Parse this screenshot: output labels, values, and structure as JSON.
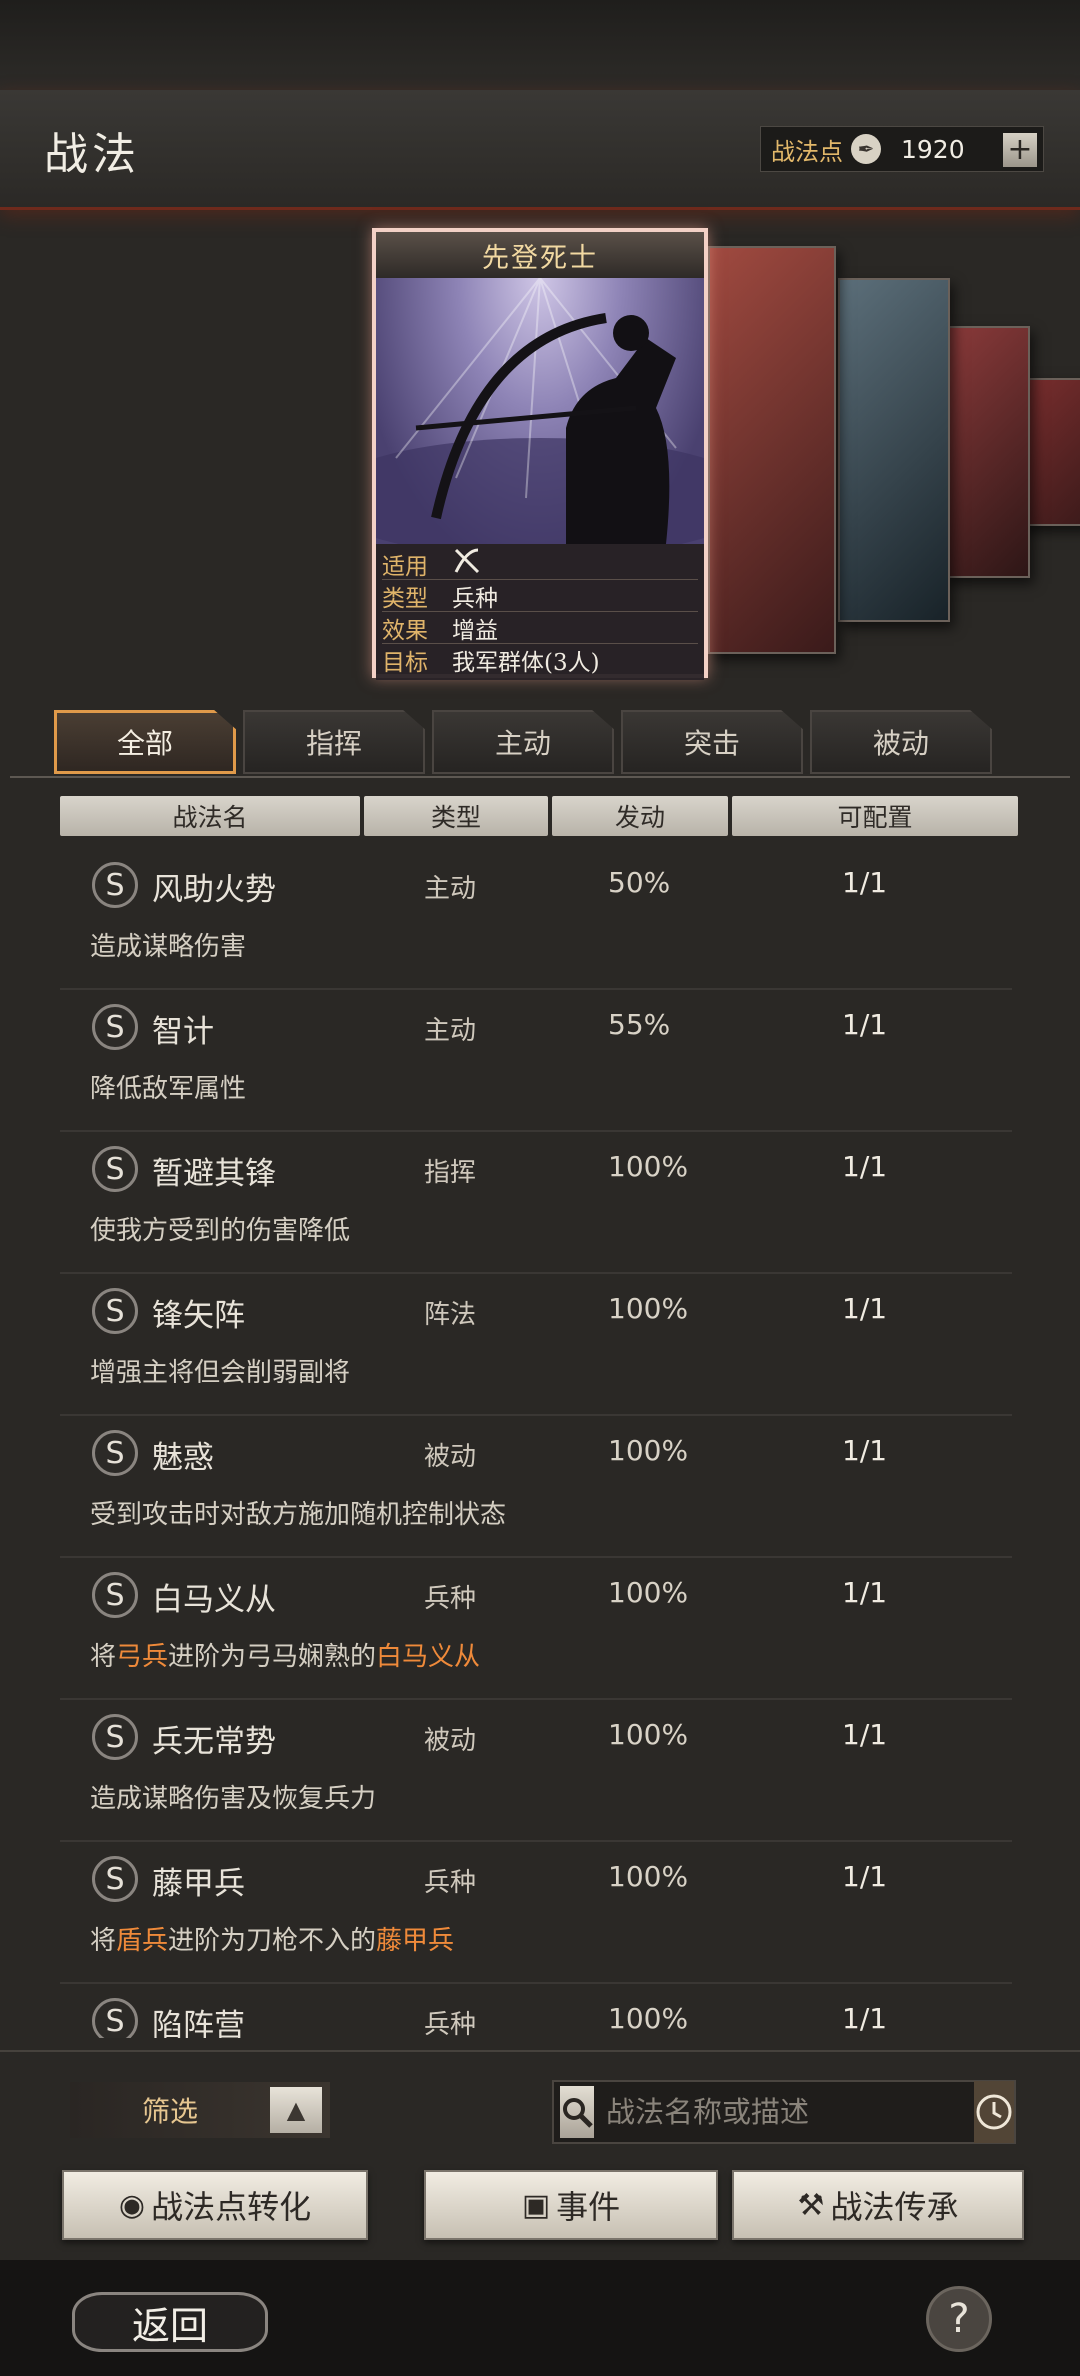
{
  "header": {
    "title": "战法",
    "points_label": "战法点",
    "points_icon": "feather-icon",
    "points_value": "1920",
    "plus_label": "+"
  },
  "card": {
    "title": "先登死士",
    "info": [
      {
        "key": "适用",
        "value": ""
      },
      {
        "key": "类型",
        "value": "兵种"
      },
      {
        "key": "效果",
        "value": "增益"
      },
      {
        "key": "目标",
        "value": "我军群体(3人)"
      }
    ],
    "applies_icon": "crossed-bow-icon"
  },
  "tabs": [
    {
      "label": "全部",
      "active": true
    },
    {
      "label": "指挥",
      "active": false
    },
    {
      "label": "主动",
      "active": false
    },
    {
      "label": "突击",
      "active": false
    },
    {
      "label": "被动",
      "active": false
    }
  ],
  "columns": [
    "战法名",
    "类型",
    "发动",
    "可配置"
  ],
  "rows": [
    {
      "grade": "S",
      "name": "风助火势",
      "type": "主动",
      "rate": "50%",
      "slots": "1/1",
      "desc": [
        {
          "t": "造成谋略伤害",
          "h": false
        }
      ]
    },
    {
      "grade": "S",
      "name": "智计",
      "type": "主动",
      "rate": "55%",
      "slots": "1/1",
      "desc": [
        {
          "t": "降低敌军属性",
          "h": false
        }
      ]
    },
    {
      "grade": "S",
      "name": "暂避其锋",
      "type": "指挥",
      "rate": "100%",
      "slots": "1/1",
      "desc": [
        {
          "t": "使我方受到的伤害降低",
          "h": false
        }
      ]
    },
    {
      "grade": "S",
      "name": "锋矢阵",
      "type": "阵法",
      "rate": "100%",
      "slots": "1/1",
      "desc": [
        {
          "t": "增强主将但会削弱副将",
          "h": false
        }
      ]
    },
    {
      "grade": "S",
      "name": "魅惑",
      "type": "被动",
      "rate": "100%",
      "slots": "1/1",
      "desc": [
        {
          "t": "受到攻击时对敌方施加随机控制状态",
          "h": false
        }
      ]
    },
    {
      "grade": "S",
      "name": "白马义从",
      "type": "兵种",
      "rate": "100%",
      "slots": "1/1",
      "desc": [
        {
          "t": "将",
          "h": false
        },
        {
          "t": "弓兵",
          "h": true
        },
        {
          "t": "进阶为弓马娴熟的",
          "h": false
        },
        {
          "t": "白马义从",
          "h": true
        }
      ]
    },
    {
      "grade": "S",
      "name": "兵无常势",
      "type": "被动",
      "rate": "100%",
      "slots": "1/1",
      "desc": [
        {
          "t": "造成谋略伤害及恢复兵力",
          "h": false
        }
      ]
    },
    {
      "grade": "S",
      "name": "藤甲兵",
      "type": "兵种",
      "rate": "100%",
      "slots": "1/1",
      "desc": [
        {
          "t": "将",
          "h": false
        },
        {
          "t": "盾兵",
          "h": true
        },
        {
          "t": "进阶为刀枪不入的",
          "h": false
        },
        {
          "t": "藤甲兵",
          "h": true
        }
      ]
    },
    {
      "grade": "S",
      "name": "陷阵营",
      "type": "兵种",
      "rate": "100%",
      "slots": "1/1",
      "desc": []
    }
  ],
  "filter": {
    "label": "筛选",
    "arrow_icon": "triangle-up-icon"
  },
  "search": {
    "placeholder": "战法名称或描述",
    "icon": "magnifier-icon",
    "history_icon": "clock-icon"
  },
  "actions": {
    "convert_label": "战法点转化",
    "event_label": "事件",
    "inherit_label": "战法传承"
  },
  "footer": {
    "back_label": "返回",
    "help_label": "?"
  },
  "colors": {
    "accent": "#e09a4a",
    "highlight": "#ef8a3a",
    "card_border": "#f3d1c6"
  }
}
